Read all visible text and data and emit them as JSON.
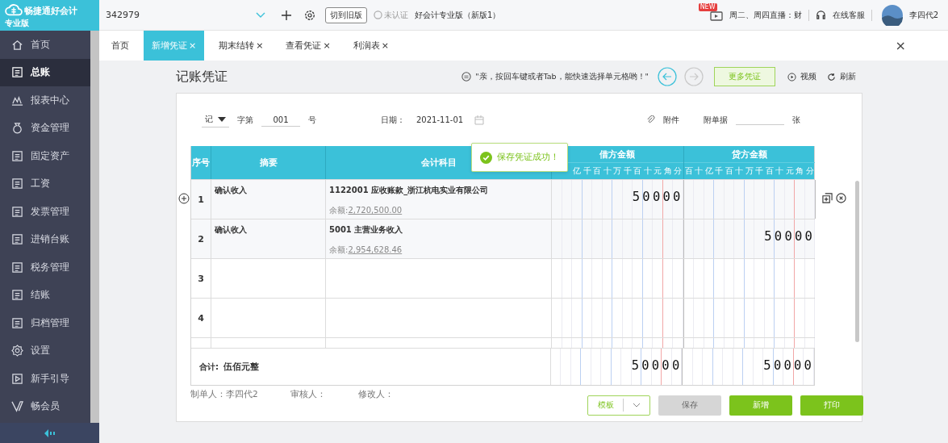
{
  "logo": {
    "name": "畅捷通好会计",
    "edition": "专业版"
  },
  "topbar": {
    "account": "342979",
    "switch_button": "切到旧版",
    "cert": "未认证",
    "product": "好会计专业版（新版1）",
    "new_badge": "NEW",
    "live": "周二、周四直播：财",
    "service": "在线客服",
    "user": "李四代2"
  },
  "sidebar": {
    "items": [
      {
        "label": "首页",
        "selected": false
      },
      {
        "label": "总账",
        "selected": true
      },
      {
        "label": "报表中心",
        "selected": false
      },
      {
        "label": "资金管理",
        "selected": false
      },
      {
        "label": "固定资产",
        "selected": false
      },
      {
        "label": "工资",
        "selected": false
      },
      {
        "label": "发票管理",
        "selected": false
      },
      {
        "label": "进销台账",
        "selected": false
      },
      {
        "label": "税务管理",
        "selected": false
      },
      {
        "label": "结账",
        "selected": false
      },
      {
        "label": "归档管理",
        "selected": false
      },
      {
        "label": "设置",
        "selected": false
      },
      {
        "label": "新手引导",
        "selected": false
      },
      {
        "label": "畅会员",
        "selected": false
      }
    ]
  },
  "tabs": [
    {
      "label": "首页",
      "selected": false
    },
    {
      "label": "新增凭证",
      "selected": true,
      "close": "×"
    },
    {
      "label": "期末结转",
      "selected": false,
      "close": "×"
    },
    {
      "label": "查看凭证",
      "selected": false,
      "close": "×"
    },
    {
      "label": "利润表",
      "selected": false,
      "close": "×"
    }
  ],
  "tabs_close": "×",
  "toolbar": {
    "title": "记账凭证",
    "hint": "\"亲，按回车键或者Tab，能快速选择单元格哟！\"",
    "prev_disabled": false,
    "next_disabled": true,
    "more": "更多凭证",
    "video": "视频",
    "refresh": "刷新"
  },
  "voucher": {
    "word": "记",
    "number_label": "字第",
    "number": "001",
    "number_suffix": "号",
    "date_label": "日期：",
    "date": "2021-11-01",
    "attachment": "附件",
    "documents_label": "附单据",
    "sheets_label": "张"
  },
  "table": {
    "columns": [
      "序号",
      "摘要",
      "会计科目",
      "借方金额",
      "贷方金额"
    ],
    "debit_units": [
      "亿",
      "千",
      "百",
      "十",
      "万",
      "千",
      "百",
      "十",
      "元",
      "角",
      "分"
    ],
    "credit_units": [
      "百",
      "十",
      "亿",
      "千",
      "百",
      "十",
      "万",
      "千",
      "百",
      "十",
      "元",
      "角",
      "分"
    ],
    "rows": [
      {
        "index": "1",
        "summary": "确认收入",
        "account": "1122001 应收账款_浙江杭电实业有限公司",
        "balance_label": "余额:",
        "balance": "2,720,500.00",
        "debit": "50000"
      },
      {
        "index": "2",
        "summary": "确认收入",
        "account": "5001 主营业务收入",
        "balance_label": "余额:",
        "balance": "2,954,628.46",
        "credit": "50000"
      },
      {
        "index": "3"
      },
      {
        "index": "4"
      }
    ],
    "total": {
      "label": "合计:",
      "words": "伍佰元整",
      "debit": "50000",
      "credit": "50000"
    }
  },
  "toast": "保存凭证成功！",
  "footer": {
    "maker": "制单人：李四代2",
    "reviewer": "审核人：",
    "modifier": "修改人："
  },
  "buttons": [
    {
      "kind": "dropdown",
      "label": "模板",
      "disabled": false
    },
    {
      "kind": "plain",
      "label": "保存",
      "disabled": true
    },
    {
      "kind": "primary",
      "label": "新增",
      "disabled": false
    },
    {
      "kind": "primary",
      "label": "打印",
      "disabled": false
    }
  ]
}
